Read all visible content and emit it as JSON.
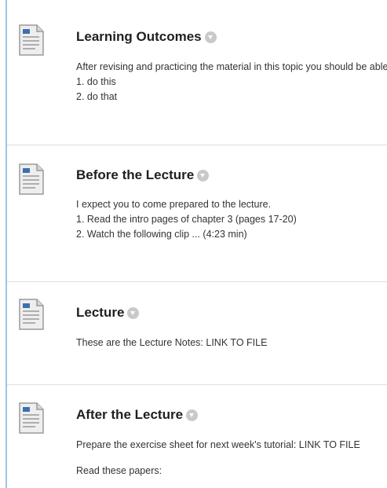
{
  "items": [
    {
      "title": "Learning Outcomes",
      "icon": "document-icon",
      "lines": [
        "After revising and practicing the material in this topic you should be able to:",
        "1. do this",
        "2. do that"
      ]
    },
    {
      "title": "Before the Lecture",
      "icon": "document-icon",
      "lines": [
        "I expect you to come prepared to the lecture.",
        "1. Read the intro pages of chapter 3 (pages 17-20)",
        "2. Watch the following clip ... (4:23 min)"
      ]
    },
    {
      "title": "Lecture",
      "icon": "document-icon",
      "lines": [
        "These are the Lecture Notes: LINK TO FILE"
      ]
    },
    {
      "title": "After the Lecture",
      "icon": "document-icon",
      "lines": [
        "Prepare the exercise sheet for next week's tutorial: LINK TO FILE",
        "Read these papers:"
      ]
    }
  ],
  "colors": {
    "left_rule": "#9fc3e6",
    "divider": "#dedede",
    "icon_accent": "#3d6fb0",
    "menu_button": "#c9c9c9"
  }
}
